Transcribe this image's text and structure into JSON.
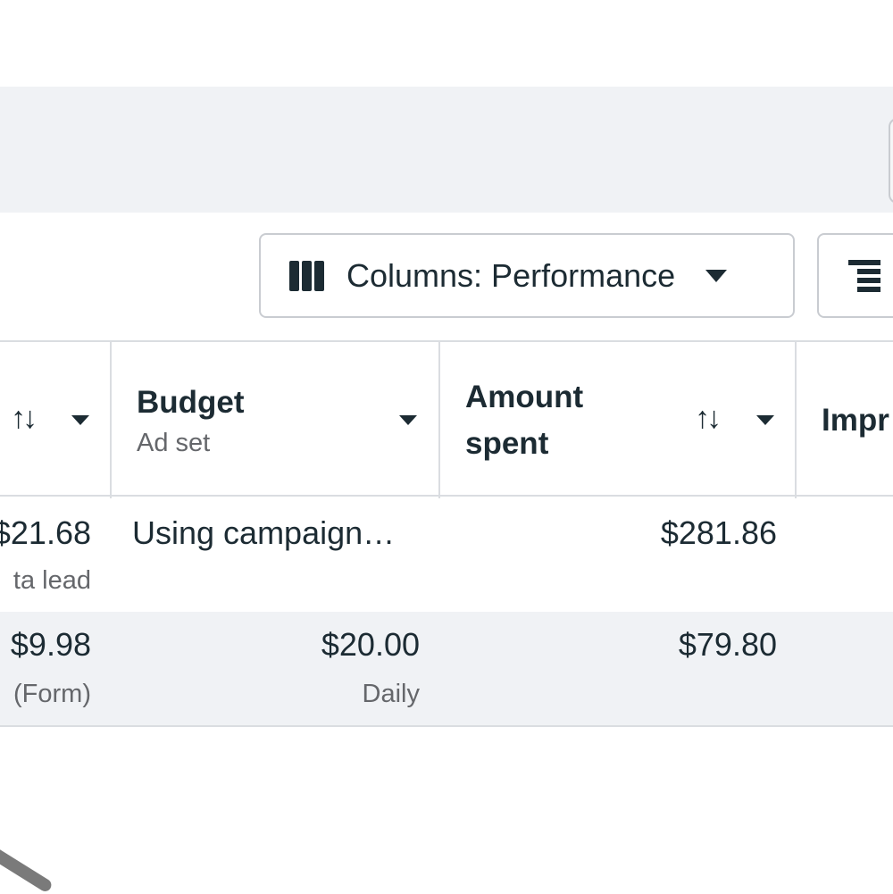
{
  "toolbar": {
    "columns_label": "Columns: Performance"
  },
  "table": {
    "headers": {
      "budget_title": "Budget",
      "budget_sub": "Ad set",
      "amount_title_1": "Amount",
      "amount_title_2": "spent",
      "impressions_partial": "Impr"
    },
    "rows": [
      {
        "result_cost": "$21.68",
        "result_cost_sub": "ta lead",
        "budget": "Using campaign…",
        "budget_sub": "",
        "amount_spent": "$281.86"
      },
      {
        "result_cost": "$9.98",
        "result_cost_sub": "(Form)",
        "budget": "$20.00",
        "budget_sub": "Daily",
        "amount_spent": "$79.80"
      }
    ]
  },
  "icons": {
    "columns": "columns-icon",
    "breakdown": "breakdown-icon",
    "sort": "sort-arrows-icon",
    "dropdown": "caret-down-icon"
  },
  "colors": {
    "band": "#f0f2f5",
    "text": "#1c2b33",
    "muted": "#65676b",
    "border": "#dadde1"
  }
}
